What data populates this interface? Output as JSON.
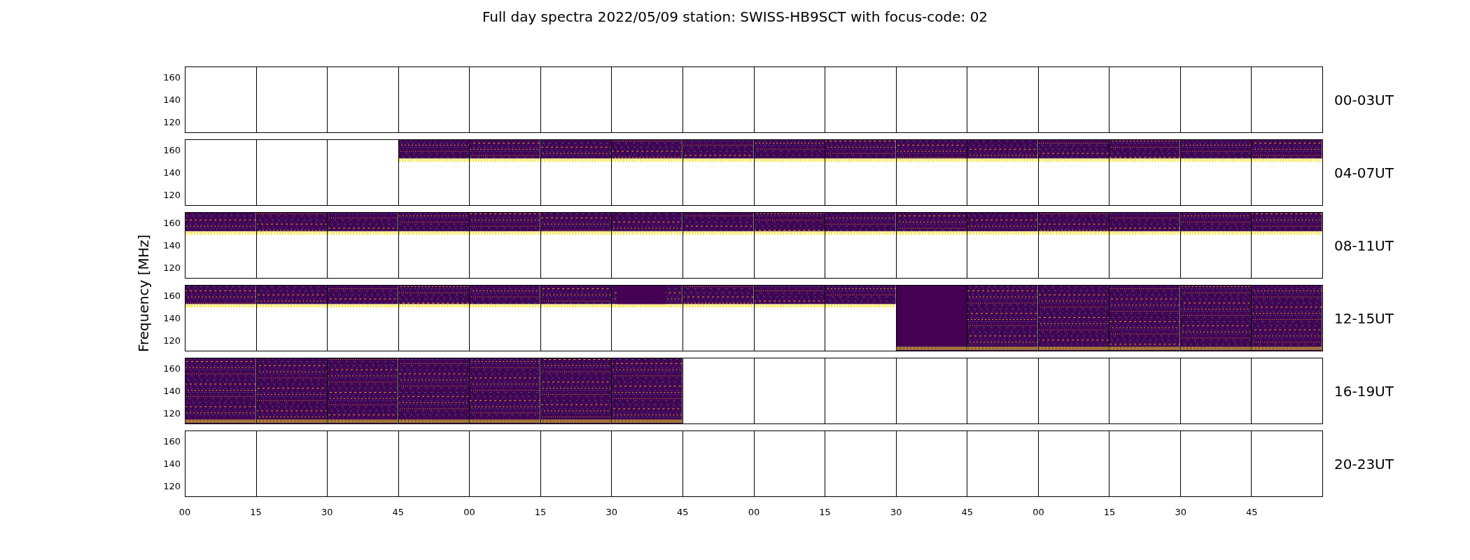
{
  "title": "Full day spectra 2022/05/09 station: SWISS-HB9SCT with focus-code: 02",
  "y_axis": {
    "label": "Frequency [MHz]"
  },
  "rows": [
    {
      "label": "00-03UT",
      "yticks": [
        "160",
        "140",
        "120"
      ],
      "cells": [
        {
          "kind": "empty"
        },
        {
          "kind": "empty"
        },
        {
          "kind": "empty"
        },
        {
          "kind": "empty"
        },
        {
          "kind": "empty"
        },
        {
          "kind": "empty"
        },
        {
          "kind": "empty"
        },
        {
          "kind": "empty"
        },
        {
          "kind": "empty"
        },
        {
          "kind": "empty"
        },
        {
          "kind": "empty"
        },
        {
          "kind": "empty"
        },
        {
          "kind": "empty"
        },
        {
          "kind": "empty"
        },
        {
          "kind": "empty"
        },
        {
          "kind": "empty"
        }
      ]
    },
    {
      "label": "04-07UT",
      "yticks": [
        "160",
        "140",
        "120"
      ],
      "cells": [
        {
          "kind": "empty"
        },
        {
          "kind": "empty"
        },
        {
          "kind": "empty"
        },
        {
          "kind": "upper"
        },
        {
          "kind": "upper"
        },
        {
          "kind": "upper"
        },
        {
          "kind": "upper"
        },
        {
          "kind": "upper"
        },
        {
          "kind": "upper"
        },
        {
          "kind": "upper"
        },
        {
          "kind": "upper"
        },
        {
          "kind": "upper"
        },
        {
          "kind": "upper"
        },
        {
          "kind": "upper"
        },
        {
          "kind": "upper"
        },
        {
          "kind": "upper"
        }
      ]
    },
    {
      "label": "08-11UT",
      "yticks": [
        "160",
        "140",
        "120"
      ],
      "cells": [
        {
          "kind": "upper"
        },
        {
          "kind": "upper"
        },
        {
          "kind": "upper"
        },
        {
          "kind": "upper"
        },
        {
          "kind": "upper"
        },
        {
          "kind": "upper"
        },
        {
          "kind": "upper"
        },
        {
          "kind": "upper"
        },
        {
          "kind": "upper"
        },
        {
          "kind": "upper"
        },
        {
          "kind": "upper"
        },
        {
          "kind": "upper"
        },
        {
          "kind": "upper"
        },
        {
          "kind": "upper"
        },
        {
          "kind": "upper"
        },
        {
          "kind": "upper"
        }
      ]
    },
    {
      "label": "12-15UT",
      "yticks": [
        "160",
        "140",
        "120"
      ],
      "cells": [
        {
          "kind": "upper"
        },
        {
          "kind": "upper"
        },
        {
          "kind": "upper"
        },
        {
          "kind": "upper"
        },
        {
          "kind": "upper"
        },
        {
          "kind": "upper"
        },
        {
          "kind": "upper-gap"
        },
        {
          "kind": "upper"
        },
        {
          "kind": "upper"
        },
        {
          "kind": "upper"
        },
        {
          "kind": "full-dark"
        },
        {
          "kind": "full"
        },
        {
          "kind": "full"
        },
        {
          "kind": "full"
        },
        {
          "kind": "full"
        },
        {
          "kind": "full"
        }
      ]
    },
    {
      "label": "16-19UT",
      "yticks": [
        "160",
        "140",
        "120"
      ],
      "cells": [
        {
          "kind": "full"
        },
        {
          "kind": "full"
        },
        {
          "kind": "full"
        },
        {
          "kind": "full"
        },
        {
          "kind": "full"
        },
        {
          "kind": "full"
        },
        {
          "kind": "full"
        },
        {
          "kind": "empty"
        },
        {
          "kind": "empty"
        },
        {
          "kind": "empty"
        },
        {
          "kind": "empty"
        },
        {
          "kind": "empty"
        },
        {
          "kind": "empty"
        },
        {
          "kind": "empty"
        },
        {
          "kind": "empty"
        },
        {
          "kind": "empty"
        }
      ]
    },
    {
      "label": "20-23UT",
      "yticks": [
        "160",
        "140",
        "120"
      ],
      "cells": [
        {
          "kind": "empty"
        },
        {
          "kind": "empty"
        },
        {
          "kind": "empty"
        },
        {
          "kind": "empty"
        },
        {
          "kind": "empty"
        },
        {
          "kind": "empty"
        },
        {
          "kind": "empty"
        },
        {
          "kind": "empty"
        },
        {
          "kind": "empty"
        },
        {
          "kind": "empty"
        },
        {
          "kind": "empty"
        },
        {
          "kind": "empty"
        },
        {
          "kind": "empty"
        },
        {
          "kind": "empty"
        },
        {
          "kind": "empty"
        },
        {
          "kind": "empty"
        }
      ]
    }
  ],
  "x_axis": {
    "ticks": [
      "00",
      "15",
      "30",
      "45",
      "00",
      "15",
      "30",
      "45",
      "00",
      "15",
      "30",
      "45",
      "00",
      "15",
      "30",
      "45"
    ]
  }
}
